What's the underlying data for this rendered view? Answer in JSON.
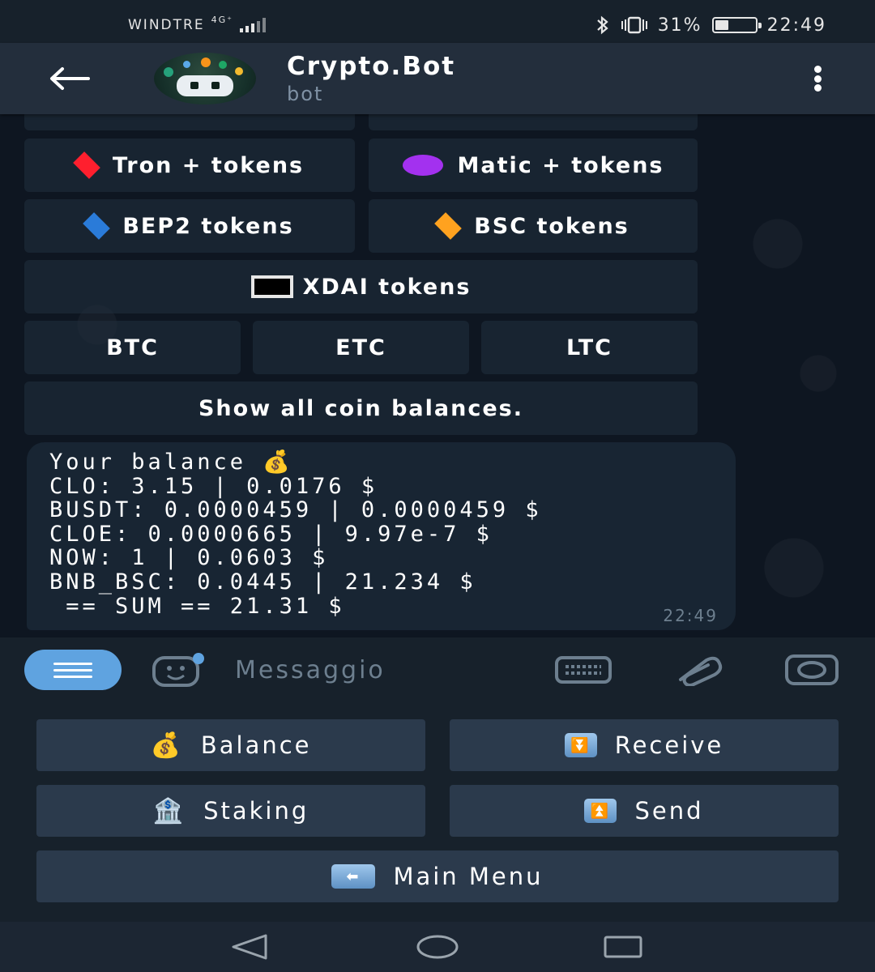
{
  "status_bar": {
    "carrier": "WINDTRE",
    "network": "4G⁺",
    "battery_percent": "31%",
    "battery_level": 0.31,
    "time": "22:49"
  },
  "header": {
    "title": "Crypto.Bot",
    "subtitle": "bot"
  },
  "inline_keyboard": {
    "row1": [
      {
        "label": "Tron + tokens",
        "icon": "red-diamond-icon",
        "color": "#ff1f2e"
      },
      {
        "label": "Matic + tokens",
        "icon": "purple-circle-icon",
        "color": "#a331ef"
      }
    ],
    "row2": [
      {
        "label": "BEP2 tokens",
        "icon": "blue-diamond-icon",
        "color": "#2a7bd9"
      },
      {
        "label": "BSC tokens",
        "icon": "orange-diamond-icon",
        "color": "#ffa21f"
      }
    ],
    "row3": {
      "label": "XDAI tokens",
      "icon": "black-square-icon"
    },
    "row4": [
      "BTC",
      "ETC",
      "LTC"
    ],
    "row5": {
      "label": "Show all coin balances."
    }
  },
  "message": {
    "lines": [
      "Your balance 💰",
      "CLO: 3.15 | 0.0176 $",
      "BUSDT: 0.0000459 | 0.0000459 $",
      "CLOE: 0.0000665 | 9.97e-7 $",
      "NOW: 1 | 0.0603 $",
      "BNB_BSC: 0.0445 | 21.234 $",
      " == SUM == 21.31 $"
    ],
    "time": "22:49"
  },
  "input": {
    "placeholder": "Messaggio"
  },
  "reply_keyboard": {
    "balance": "Balance",
    "receive": "Receive",
    "staking": "Staking",
    "send": "Send",
    "main_menu": "Main Menu"
  },
  "colors": {
    "accent": "#5fa3e0",
    "background": "#0e1621",
    "header": "#232e3c",
    "button": "#2b3a4c"
  }
}
